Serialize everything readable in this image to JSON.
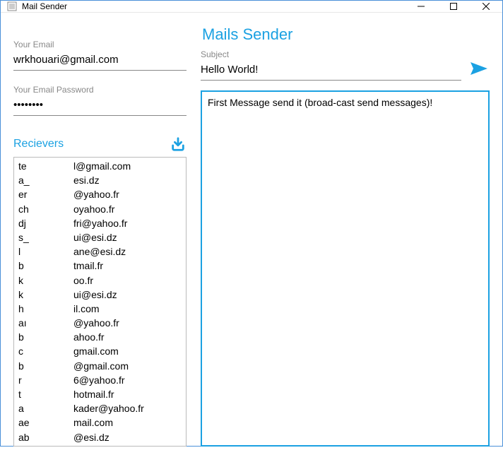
{
  "window": {
    "title": "Mail Sender"
  },
  "app_title": "Mails Sender",
  "email": {
    "label": "Your Email",
    "value": "wrkhouari@gmail.com"
  },
  "password": {
    "label": "Your Email Password",
    "value": "••••••••"
  },
  "receivers": {
    "title": "Recievers",
    "items": [
      {
        "c1": "te",
        "c2": "l@gmail.com"
      },
      {
        "c1": "a_",
        "c2": "esi.dz"
      },
      {
        "c1": "er",
        "c2": "@yahoo.fr"
      },
      {
        "c1": "ch",
        "c2": "oyahoo.fr"
      },
      {
        "c1": "dj",
        "c2": "fri@yahoo.fr"
      },
      {
        "c1": "s_",
        "c2": "ui@esi.dz"
      },
      {
        "c1": "l",
        "c2": "ane@esi.dz"
      },
      {
        "c1": "b",
        "c2": "tmail.fr"
      },
      {
        "c1": "k",
        "c2": "oo.fr"
      },
      {
        "c1": "k",
        "c2": "ui@esi.dz"
      },
      {
        "c1": "h",
        "c2": "il.com"
      },
      {
        "c1": "aı",
        "c2": "@yahoo.fr"
      },
      {
        "c1": "b",
        "c2": "ahoo.fr"
      },
      {
        "c1": "c",
        "c2": "gmail.com"
      },
      {
        "c1": "b",
        "c2": "@gmail.com"
      },
      {
        "c1": "r",
        "c2": "6@yahoo.fr"
      },
      {
        "c1": "t",
        "c2": "hotmail.fr"
      },
      {
        "c1": "a",
        "c2": "kader@yahoo.fr"
      },
      {
        "c1": "ae",
        "c2": "mail.com"
      },
      {
        "c1": "ab",
        "c2": "@esi.dz"
      }
    ]
  },
  "subject": {
    "label": "Subject",
    "value": "Hello World!"
  },
  "message": {
    "value": "First Message send it (broad-cast send messages)!"
  },
  "colors": {
    "accent": "#1ba1e2"
  }
}
